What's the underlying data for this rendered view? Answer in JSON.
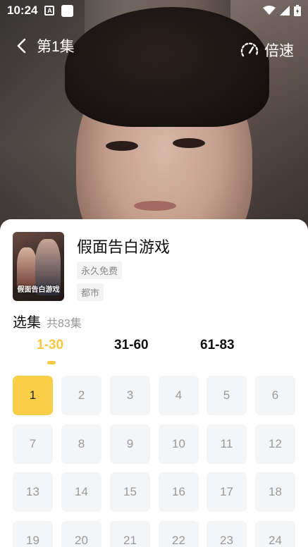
{
  "status_bar": {
    "time": "10:24"
  },
  "header": {
    "episode_title": "第1集",
    "speed_label": "倍速"
  },
  "drama": {
    "title": "假面告白游戏",
    "poster_text": "假面告白游戏",
    "tags": [
      "永久免费",
      "都市"
    ]
  },
  "episodes": {
    "heading": "选集",
    "count": "共83集",
    "ranges": [
      "1-30",
      "31-60",
      "61-83"
    ],
    "active_range": 0,
    "items": [
      "1",
      "2",
      "3",
      "4",
      "5",
      "6",
      "7",
      "8",
      "9",
      "10",
      "11",
      "12",
      "13",
      "14",
      "15",
      "16",
      "17",
      "18",
      "19",
      "20",
      "21",
      "22",
      "23",
      "24"
    ],
    "active_item": 0
  },
  "colors": {
    "accent": "#f9cf4a",
    "tab_active": "#f7c843"
  }
}
